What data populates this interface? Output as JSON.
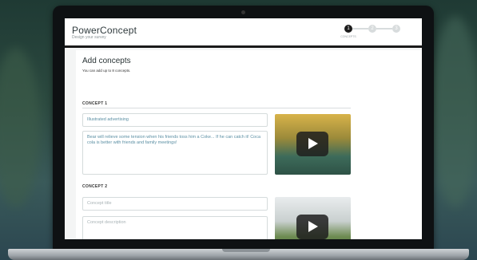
{
  "app": {
    "brand": "PowerConcept",
    "subtitle": "Design your survey"
  },
  "steps": [
    {
      "number": "1",
      "label": "CONCEPTS",
      "state": "active"
    },
    {
      "number": "2",
      "label": "",
      "state": "inactive"
    },
    {
      "number": "3",
      "label": "",
      "state": "inactive"
    }
  ],
  "page": {
    "title": "Add concepts",
    "hint": "You can add up to 8 concepts."
  },
  "concepts": [
    {
      "section_label": "CONCEPT 1",
      "title_value": "Illustrated advertising",
      "title_placeholder": "",
      "description_value": "Bear will relieve some tension when his friends toss him a Coke... If he can catch it! Coca cola is better with friends and family meetings!",
      "description_placeholder": "",
      "media_icon": "play-icon"
    },
    {
      "section_label": "CONCEPT 2",
      "title_value": "",
      "title_placeholder": "Concept title",
      "description_value": "",
      "description_placeholder": "Concept description",
      "media_icon": "play-icon"
    }
  ],
  "colors": {
    "accent_dark": "#1a1a1a",
    "field_text": "#5b8fa3",
    "background": "#2c4a40"
  }
}
